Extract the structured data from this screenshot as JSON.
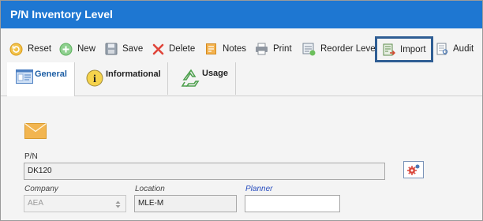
{
  "window": {
    "title": "P/N Inventory Level"
  },
  "toolbar": {
    "reset": "Reset",
    "new": "New",
    "save": "Save",
    "delete": "Delete",
    "notes": "Notes",
    "print": "Print",
    "reorder": "Reorder Level",
    "import": "Import",
    "audit": "Audit"
  },
  "tabs": [
    {
      "label": "General",
      "active": true,
      "icon": "general-form-icon"
    },
    {
      "label": "Informational",
      "active": false,
      "icon": "info-icon"
    },
    {
      "label": "Usage",
      "active": false,
      "icon": "recycle-icon"
    }
  ],
  "form": {
    "pn_label": "P/N",
    "pn_value": "DK120",
    "company_label": "Company",
    "company_value": "AEA",
    "location_label": "Location",
    "location_value": "MLE-M",
    "planner_label": "Planner",
    "planner_value": ""
  },
  "colors": {
    "titlebar": "#1e77d2",
    "selected_outline": "#2f5e94",
    "active_tab_text": "#1e5fa5",
    "planner_label": "#2a4fbf"
  }
}
